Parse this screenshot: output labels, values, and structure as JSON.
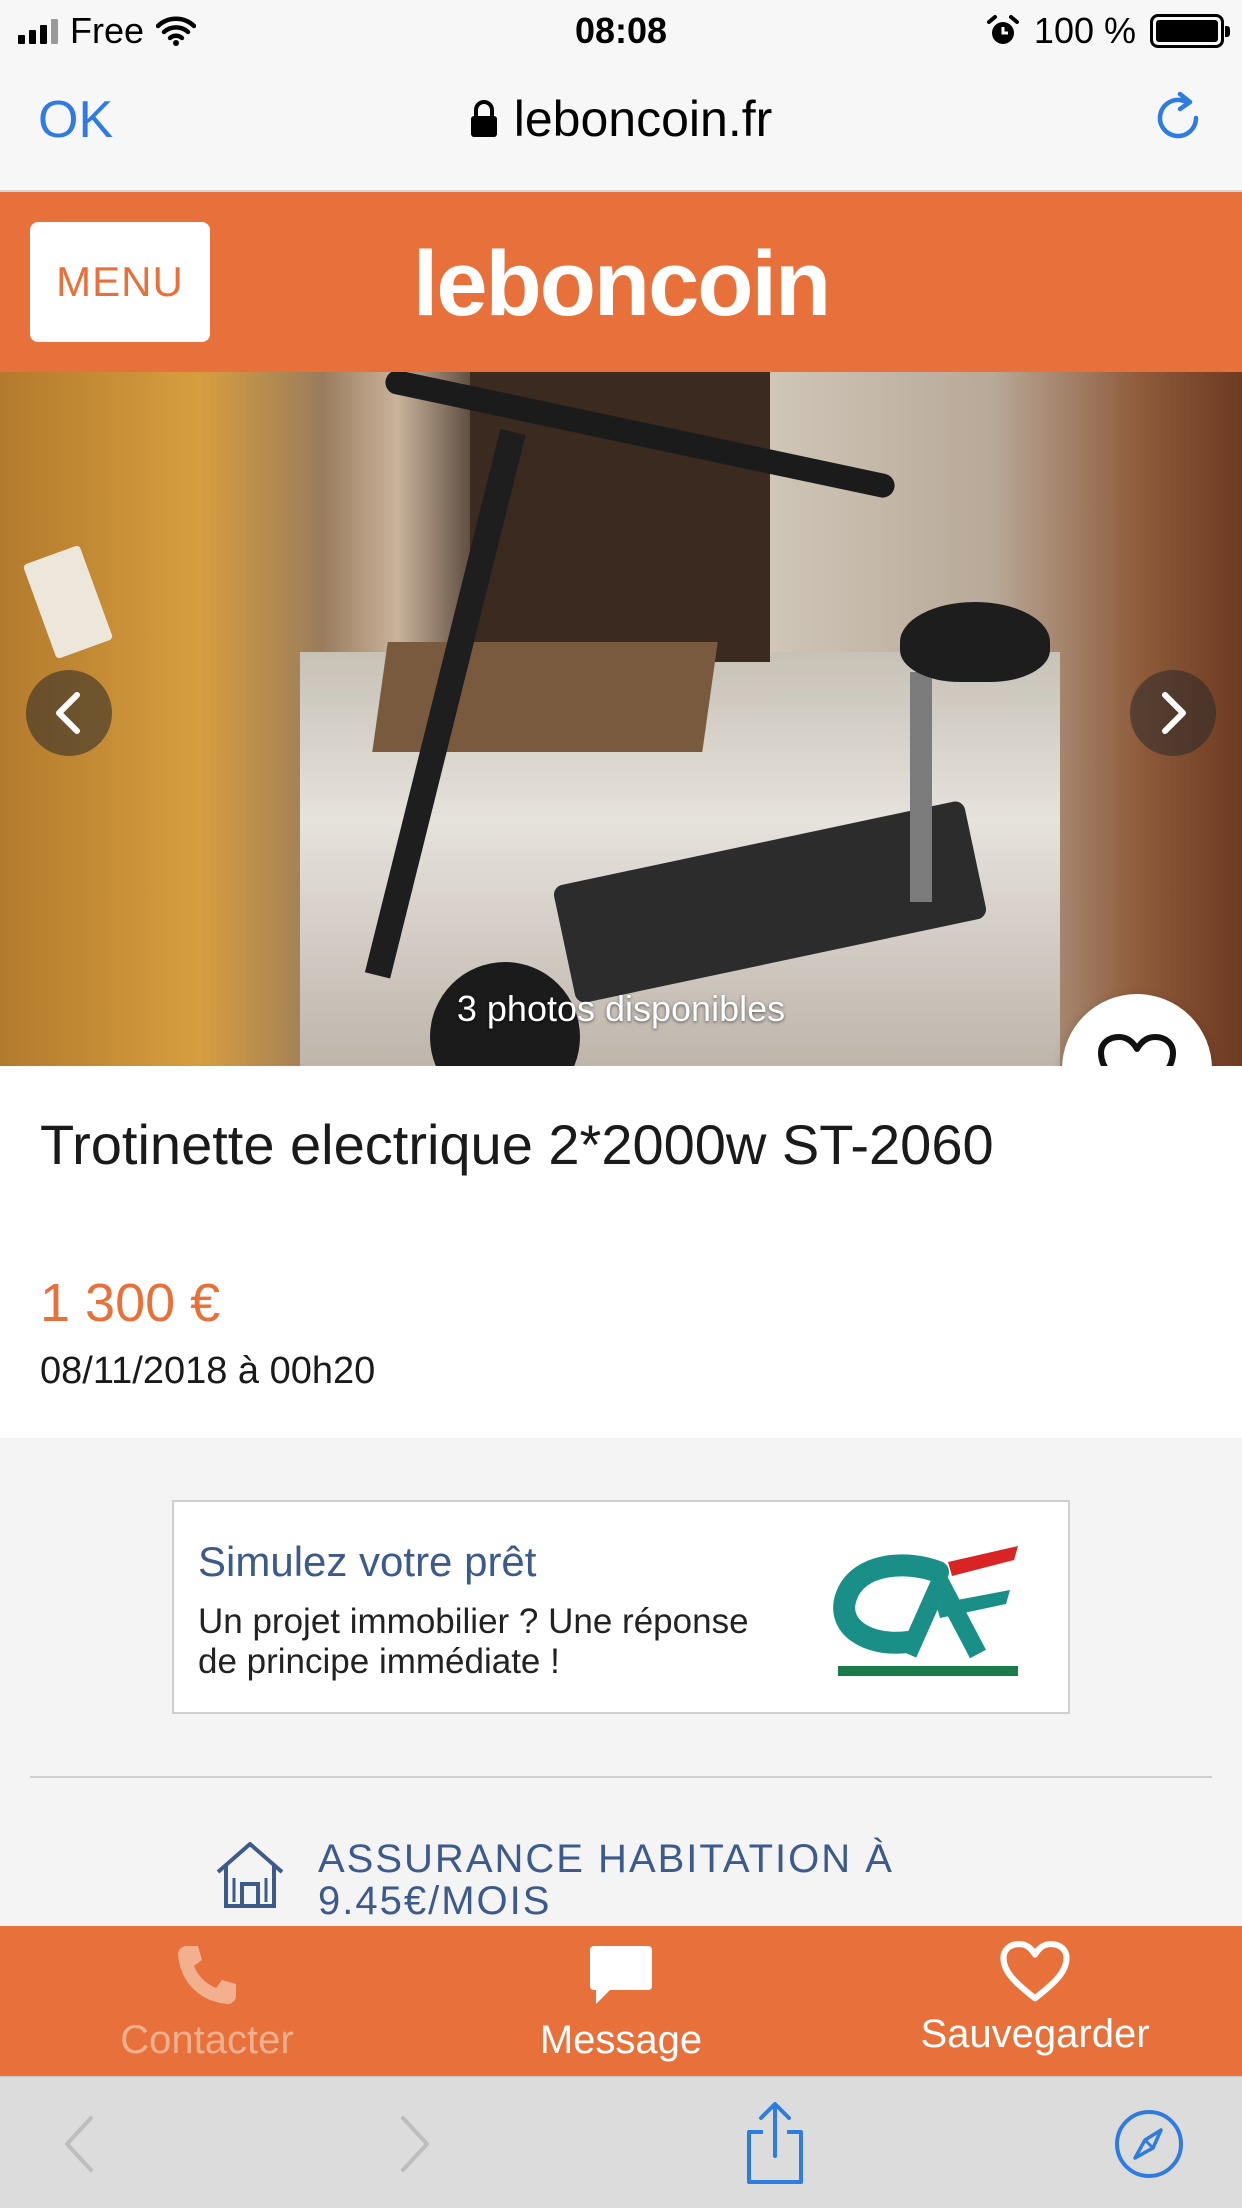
{
  "status_bar": {
    "carrier": "Free",
    "time": "08:08",
    "battery_text": "100 %"
  },
  "browser": {
    "done_label": "OK",
    "url": "leboncoin.fr"
  },
  "header": {
    "menu_label": "MENU",
    "logo_text": "leboncoin"
  },
  "gallery": {
    "caption": "3 photos disponibles"
  },
  "listing": {
    "title": "Trotinette electrique 2*2000w ST-2060",
    "price": "1 300 €",
    "date": "08/11/2018 à 00h20"
  },
  "ad": {
    "title": "Simulez votre prêt",
    "body": "Un projet immobilier ? Une réponse de principe immédiate !"
  },
  "insurance": {
    "text": "ASSURANCE HABITATION À 9.45€/MOIS"
  },
  "actions": [
    {
      "label": "Contacter",
      "icon": "phone-icon"
    },
    {
      "label": "Message",
      "icon": "chat-bubble-icon"
    },
    {
      "label": "Sauvegarder",
      "icon": "heart-icon"
    }
  ],
  "colors": {
    "brand_orange": "#e8703a",
    "ios_blue": "#2f7ce0",
    "ad_title_blue": "#3c5b8c"
  }
}
